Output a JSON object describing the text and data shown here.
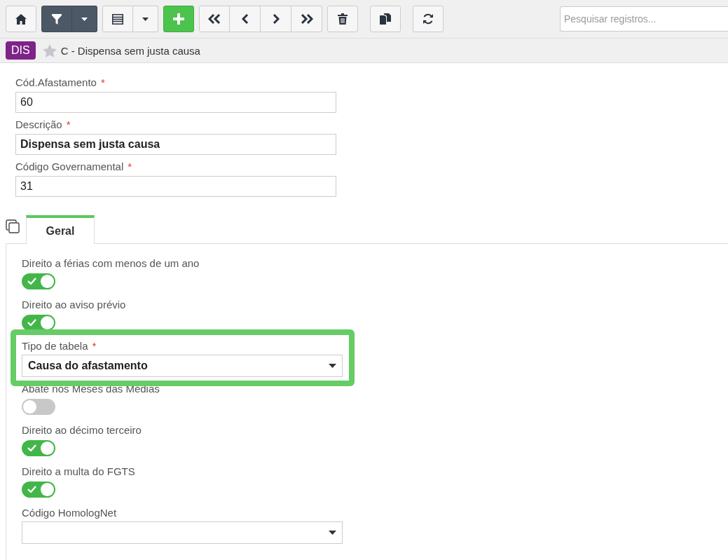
{
  "toolbar": {
    "filter_active": true
  },
  "search": {
    "placeholder": "Pesquisar registros..."
  },
  "record": {
    "badge": "DIS",
    "starred": false,
    "title": "C - Dispensa sem justa causa"
  },
  "header_fields": [
    {
      "label": "Cód.Afastamento",
      "required_mark": "*",
      "value": "60",
      "bold": false
    },
    {
      "label": "Descrição",
      "required_mark": "*",
      "value": "Dispensa sem justa causa",
      "bold": true
    },
    {
      "label": "Código Governamental",
      "required_mark": "*",
      "value": "31",
      "bold": false
    }
  ],
  "tabs": [
    {
      "label": "Geral",
      "selected": true
    }
  ],
  "general_fields": [
    {
      "kind": "toggle",
      "label": "Direito a férias com menos de um ano",
      "on": true
    },
    {
      "kind": "toggle",
      "label": "Direito ao aviso prévio",
      "on": true
    },
    {
      "kind": "select",
      "label": "Tipo de tabela",
      "required_mark": "*",
      "value": "Causa do afastamento",
      "highlighted": true
    },
    {
      "kind": "toggle",
      "label": "Abate nos Meses das Médias",
      "on": false
    },
    {
      "kind": "toggle",
      "label": "Direito ao décimo terceiro",
      "on": true
    },
    {
      "kind": "toggle",
      "label": "Direito a multa do FGTS",
      "on": true
    },
    {
      "kind": "select",
      "label": "Código HomologNet",
      "highlighted": false
    }
  ]
}
